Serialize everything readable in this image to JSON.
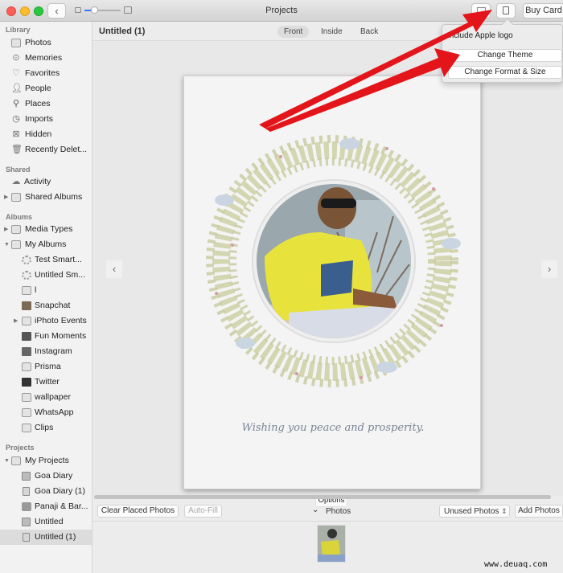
{
  "window": {
    "title": "Projects",
    "buy_card_label": "Buy Card"
  },
  "sidebar": {
    "sections": [
      {
        "title": "Library",
        "items": [
          {
            "label": "Photos",
            "icon": "photos-icon"
          },
          {
            "label": "Memories",
            "icon": "memories-icon"
          },
          {
            "label": "Favorites",
            "icon": "heart-icon"
          },
          {
            "label": "People",
            "icon": "person-icon"
          },
          {
            "label": "Places",
            "icon": "pin-icon"
          },
          {
            "label": "Imports",
            "icon": "clock-icon"
          },
          {
            "label": "Hidden",
            "icon": "hidden-icon"
          },
          {
            "label": "Recently Delet...",
            "icon": "trash-icon"
          }
        ]
      },
      {
        "title": "Shared",
        "items": [
          {
            "label": "Activity",
            "icon": "cloud-icon"
          },
          {
            "label": "Shared Albums",
            "icon": "folder-icon"
          }
        ]
      },
      {
        "title": "Albums",
        "items": [
          {
            "label": "Media Types",
            "icon": "folder-icon"
          },
          {
            "label": "My Albums",
            "icon": "folder-icon"
          },
          {
            "label": "Test Smart...",
            "icon": "smart-album-icon"
          },
          {
            "label": "Untitled Sm...",
            "icon": "smart-album-icon"
          },
          {
            "label": "l",
            "icon": "album-icon"
          },
          {
            "label": "Snapchat",
            "icon": "album-thumb-icon"
          },
          {
            "label": "iPhoto Events",
            "icon": "folder-icon"
          },
          {
            "label": "Fun Moments",
            "icon": "album-thumb-icon"
          },
          {
            "label": "Instagram",
            "icon": "album-thumb-icon"
          },
          {
            "label": "Prisma",
            "icon": "album-icon"
          },
          {
            "label": "Twitter",
            "icon": "album-thumb-icon"
          },
          {
            "label": "wallpaper",
            "icon": "album-icon"
          },
          {
            "label": "WhatsApp",
            "icon": "album-icon"
          },
          {
            "label": "Clips",
            "icon": "album-icon"
          }
        ]
      },
      {
        "title": "Projects",
        "items": [
          {
            "label": "My Projects",
            "icon": "folder-icon"
          },
          {
            "label": "Goa Diary",
            "icon": "book-icon"
          },
          {
            "label": "Goa Diary (1)",
            "icon": "card-icon"
          },
          {
            "label": "Panaji & Bar...",
            "icon": "calendar-icon"
          },
          {
            "label": "Untitled",
            "icon": "book-icon"
          },
          {
            "label": "Untitled (1)",
            "icon": "card-icon",
            "selected": true
          }
        ]
      }
    ]
  },
  "main": {
    "project_title": "Untitled (1)",
    "tabs": [
      "Front",
      "Inside",
      "Back"
    ],
    "active_tab": "Front",
    "card_greeting": "Wishing you peace and prosperity.",
    "options_label": "Options",
    "bottom_bar": {
      "clear_label": "Clear Placed Photos",
      "autofill_label": "Auto-Fill",
      "photos_label": "Photos",
      "filter_value": "Unused Photos",
      "add_photos_label": "Add Photos"
    }
  },
  "popover": {
    "checkbox_label": "Include Apple logo",
    "change_theme_label": "Change Theme",
    "change_format_label": "Change Format & Size"
  },
  "annotations": {
    "arrow_color": "#e3151a"
  },
  "watermark": "www.deuaq.com"
}
